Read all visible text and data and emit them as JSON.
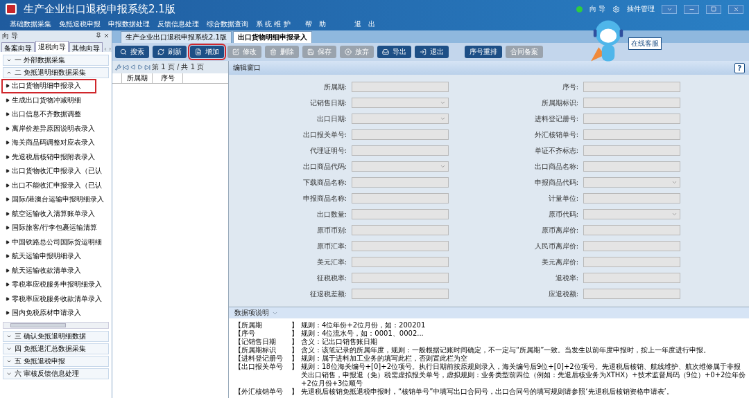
{
  "window": {
    "title": "生产企业出口退税申报系统2.1版",
    "top_links": [
      "向 导",
      "插件管理"
    ]
  },
  "menu": [
    "基础数据采集",
    "免抵退税申报",
    "申报数据处理",
    "反馈信息处理",
    "综合数据查询",
    "系 统 维 护",
    "帮　助",
    "退　出"
  ],
  "sidebar": {
    "title": "向 导",
    "tabs": [
      {
        "label": "备案向导",
        "selected": false
      },
      {
        "label": "退税向导",
        "selected": true
      },
      {
        "label": "其他向导",
        "selected": false
      }
    ],
    "groups_top": [
      {
        "label": "一  外部数据采集",
        "expanded": false
      },
      {
        "label": "二  免抵退明细数据采集",
        "expanded": true
      }
    ],
    "items": [
      {
        "label": "出口货物明细申报录入",
        "highlighted": true
      },
      {
        "label": "生成出口货物冲减明细",
        "highlighted": false
      },
      {
        "label": "出口信息不齐数据调整",
        "highlighted": false
      },
      {
        "label": "离岸价差异原因说明表录入",
        "highlighted": false
      },
      {
        "label": "海关商品码调整对应表录入",
        "highlighted": false
      },
      {
        "label": "先退税后核销申报附表录入",
        "highlighted": false
      },
      {
        "label": "出口货物收汇申报录入（已认",
        "highlighted": false
      },
      {
        "label": "出口不能收汇申报录入（已认",
        "highlighted": false
      },
      {
        "label": "国际/港澳台运输申报明细录入",
        "highlighted": false
      },
      {
        "label": "航空运输收入清算账单录入",
        "highlighted": false
      },
      {
        "label": "国际旅客/行李包裹运输清算",
        "highlighted": false
      },
      {
        "label": "中国铁路总公司国际货运明细",
        "highlighted": false
      },
      {
        "label": "航天运输申报明细录入",
        "highlighted": false
      },
      {
        "label": "航天运输收款清单录入",
        "highlighted": false
      },
      {
        "label": "零税率应税服务申报明细录入",
        "highlighted": false
      },
      {
        "label": "零税率应税服务收款清单录入",
        "highlighted": false
      },
      {
        "label": "国内免税原材申请录入",
        "highlighted": false
      }
    ],
    "groups_bottom": [
      {
        "label": "三  确认免抵退明细数据",
        "expanded": false
      },
      {
        "label": "四  免抵退汇总数据采集",
        "expanded": false
      },
      {
        "label": "五  免抵退税申报",
        "expanded": false
      },
      {
        "label": "六  审核反馈信息处理",
        "expanded": false
      }
    ]
  },
  "doc_tabs": [
    {
      "label": "生产企业出口退税申报系统2.1版",
      "selected": false
    },
    {
      "label": "出口货物明细申报录入",
      "selected": true
    }
  ],
  "toolbar": [
    {
      "label": "搜索",
      "kind": "search",
      "disabled": false,
      "highlighted": false
    },
    {
      "label": "刷新",
      "kind": "refresh",
      "disabled": false,
      "highlighted": false
    },
    {
      "label": "增加",
      "kind": "add",
      "disabled": false,
      "highlighted": true
    },
    {
      "label": "修改",
      "kind": "edit",
      "disabled": true,
      "highlighted": false
    },
    {
      "label": "删除",
      "kind": "delete",
      "disabled": true,
      "highlighted": false
    },
    {
      "label": "保存",
      "kind": "save",
      "disabled": true,
      "highlighted": false
    },
    {
      "label": "放弃",
      "kind": "cancel",
      "disabled": true,
      "highlighted": false
    },
    {
      "label": "导出",
      "kind": "export",
      "disabled": false,
      "highlighted": false
    },
    {
      "label": "退出",
      "kind": "exit",
      "disabled": false,
      "highlighted": false
    },
    {
      "label": "序号重排",
      "kind": "plain",
      "disabled": false,
      "highlighted": false
    },
    {
      "label": "合同备案",
      "kind": "plain",
      "disabled": true,
      "highlighted": false
    }
  ],
  "service_badge": "在线客服",
  "pager": {
    "text": "第 1 页 / 共 1 页"
  },
  "grid": {
    "columns": [
      "所属期",
      "序号"
    ]
  },
  "editor": {
    "title": "编辑窗口",
    "help": "?",
    "rows": [
      [
        {
          "label": "所属期:",
          "kind": "text"
        },
        {
          "label": "序号:",
          "kind": "text"
        }
      ],
      [
        {
          "label": "记销售日期:",
          "kind": "select"
        },
        {
          "label": "所属期标识:",
          "kind": "text"
        }
      ],
      [
        {
          "label": "出口日期:",
          "kind": "select"
        },
        {
          "label": "进料登记册号:",
          "kind": "text"
        }
      ],
      [
        {
          "label": "出口报关单号:",
          "kind": "text"
        },
        {
          "label": "外汇核销单号:",
          "kind": "text"
        }
      ],
      [
        {
          "label": "代理证明号:",
          "kind": "text"
        },
        {
          "label": "单证不齐标志:",
          "kind": "text"
        }
      ],
      [
        {
          "label": "出口商品代码:",
          "kind": "select"
        },
        {
          "label": "出口商品名称:",
          "kind": "text"
        }
      ],
      [
        {
          "label": "下载商品名称:",
          "kind": "text"
        },
        {
          "label": "申报商品代码:",
          "kind": "select"
        }
      ],
      [
        {
          "label": "申报商品名称:",
          "kind": "text"
        },
        {
          "label": "计量单位:",
          "kind": "text"
        }
      ],
      [
        {
          "label": "出口数量:",
          "kind": "text"
        },
        {
          "label": "原币代码:",
          "kind": "select"
        }
      ],
      [
        {
          "label": "原币币别:",
          "kind": "text"
        },
        {
          "label": "原币离岸价:",
          "kind": "text"
        }
      ],
      [
        {
          "label": "原币汇率:",
          "kind": "text"
        },
        {
          "label": "人民币离岸价:",
          "kind": "text"
        }
      ],
      [
        {
          "label": "美元汇率:",
          "kind": "text"
        },
        {
          "label": "美元离岸价:",
          "kind": "text"
        }
      ],
      [
        {
          "label": "征税税率:",
          "kind": "text"
        },
        {
          "label": "退税率:",
          "kind": "text"
        }
      ],
      [
        {
          "label": "征退税差额:",
          "kind": "text"
        },
        {
          "label": "应退税额:",
          "kind": "text"
        }
      ]
    ]
  },
  "notes": {
    "title": "数据项说明",
    "items": [
      {
        "key": "【所属期",
        "end": "】",
        "text": "规则：4位年份+2位月份，如：200201"
      },
      {
        "key": "【序号",
        "end": "】",
        "text": "规则：4位流水号，如：0001、0002..."
      },
      {
        "key": "【记销售日期",
        "end": "】",
        "text": "含义：记出口销售账日期"
      },
      {
        "key": "【所属期标识",
        "end": "】",
        "text": "含义：该笔记录的所属年度，规则：一般根据记账时间确定，不一定与“所属期”一致。当发生以前年度申报时，按上一年度进行申报。"
      },
      {
        "key": "【进料登记册号",
        "end": "】",
        "text": "规则：属于进料加工业务的填写此栏，否则置此栏为空"
      },
      {
        "key": "【出口报关单号",
        "end": "】",
        "text": "规则：18位海关编号+[0]+2位项号。执行日期前按原规则录入，海关编号后9位+[0]+2位项号。先退税后核销、航线维护、航次维修属于非报关出口销售，申报退（免）税需虚拟报关单号，虚拟规则：业务类型前四位（例如：先退后核业务为XTHX）+技术监督局码（9位）+0+2位年份+2位月份+3位顺号"
      },
      {
        "key": "【外汇核销单号",
        "end": "】",
        "text": "先退税后核销免抵退税申报时，“核销单号”中填写出口合同号，出口合同号的填写规则请参照‘先退税后核销资格申请表’。"
      }
    ]
  }
}
